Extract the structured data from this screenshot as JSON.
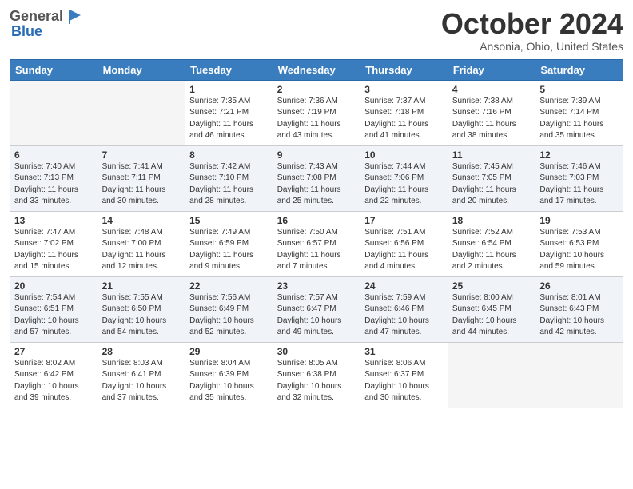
{
  "header": {
    "logo_general": "General",
    "logo_blue": "Blue",
    "month_title": "October 2024",
    "location": "Ansonia, Ohio, United States"
  },
  "days_of_week": [
    "Sunday",
    "Monday",
    "Tuesday",
    "Wednesday",
    "Thursday",
    "Friday",
    "Saturday"
  ],
  "weeks": [
    [
      {
        "day": "",
        "empty": true
      },
      {
        "day": "",
        "empty": true
      },
      {
        "day": "1",
        "sunrise": "Sunrise: 7:35 AM",
        "sunset": "Sunset: 7:21 PM",
        "daylight": "Daylight: 11 hours and 46 minutes."
      },
      {
        "day": "2",
        "sunrise": "Sunrise: 7:36 AM",
        "sunset": "Sunset: 7:19 PM",
        "daylight": "Daylight: 11 hours and 43 minutes."
      },
      {
        "day": "3",
        "sunrise": "Sunrise: 7:37 AM",
        "sunset": "Sunset: 7:18 PM",
        "daylight": "Daylight: 11 hours and 41 minutes."
      },
      {
        "day": "4",
        "sunrise": "Sunrise: 7:38 AM",
        "sunset": "Sunset: 7:16 PM",
        "daylight": "Daylight: 11 hours and 38 minutes."
      },
      {
        "day": "5",
        "sunrise": "Sunrise: 7:39 AM",
        "sunset": "Sunset: 7:14 PM",
        "daylight": "Daylight: 11 hours and 35 minutes."
      }
    ],
    [
      {
        "day": "6",
        "sunrise": "Sunrise: 7:40 AM",
        "sunset": "Sunset: 7:13 PM",
        "daylight": "Daylight: 11 hours and 33 minutes."
      },
      {
        "day": "7",
        "sunrise": "Sunrise: 7:41 AM",
        "sunset": "Sunset: 7:11 PM",
        "daylight": "Daylight: 11 hours and 30 minutes."
      },
      {
        "day": "8",
        "sunrise": "Sunrise: 7:42 AM",
        "sunset": "Sunset: 7:10 PM",
        "daylight": "Daylight: 11 hours and 28 minutes."
      },
      {
        "day": "9",
        "sunrise": "Sunrise: 7:43 AM",
        "sunset": "Sunset: 7:08 PM",
        "daylight": "Daylight: 11 hours and 25 minutes."
      },
      {
        "day": "10",
        "sunrise": "Sunrise: 7:44 AM",
        "sunset": "Sunset: 7:06 PM",
        "daylight": "Daylight: 11 hours and 22 minutes."
      },
      {
        "day": "11",
        "sunrise": "Sunrise: 7:45 AM",
        "sunset": "Sunset: 7:05 PM",
        "daylight": "Daylight: 11 hours and 20 minutes."
      },
      {
        "day": "12",
        "sunrise": "Sunrise: 7:46 AM",
        "sunset": "Sunset: 7:03 PM",
        "daylight": "Daylight: 11 hours and 17 minutes."
      }
    ],
    [
      {
        "day": "13",
        "sunrise": "Sunrise: 7:47 AM",
        "sunset": "Sunset: 7:02 PM",
        "daylight": "Daylight: 11 hours and 15 minutes."
      },
      {
        "day": "14",
        "sunrise": "Sunrise: 7:48 AM",
        "sunset": "Sunset: 7:00 PM",
        "daylight": "Daylight: 11 hours and 12 minutes."
      },
      {
        "day": "15",
        "sunrise": "Sunrise: 7:49 AM",
        "sunset": "Sunset: 6:59 PM",
        "daylight": "Daylight: 11 hours and 9 minutes."
      },
      {
        "day": "16",
        "sunrise": "Sunrise: 7:50 AM",
        "sunset": "Sunset: 6:57 PM",
        "daylight": "Daylight: 11 hours and 7 minutes."
      },
      {
        "day": "17",
        "sunrise": "Sunrise: 7:51 AM",
        "sunset": "Sunset: 6:56 PM",
        "daylight": "Daylight: 11 hours and 4 minutes."
      },
      {
        "day": "18",
        "sunrise": "Sunrise: 7:52 AM",
        "sunset": "Sunset: 6:54 PM",
        "daylight": "Daylight: 11 hours and 2 minutes."
      },
      {
        "day": "19",
        "sunrise": "Sunrise: 7:53 AM",
        "sunset": "Sunset: 6:53 PM",
        "daylight": "Daylight: 10 hours and 59 minutes."
      }
    ],
    [
      {
        "day": "20",
        "sunrise": "Sunrise: 7:54 AM",
        "sunset": "Sunset: 6:51 PM",
        "daylight": "Daylight: 10 hours and 57 minutes."
      },
      {
        "day": "21",
        "sunrise": "Sunrise: 7:55 AM",
        "sunset": "Sunset: 6:50 PM",
        "daylight": "Daylight: 10 hours and 54 minutes."
      },
      {
        "day": "22",
        "sunrise": "Sunrise: 7:56 AM",
        "sunset": "Sunset: 6:49 PM",
        "daylight": "Daylight: 10 hours and 52 minutes."
      },
      {
        "day": "23",
        "sunrise": "Sunrise: 7:57 AM",
        "sunset": "Sunset: 6:47 PM",
        "daylight": "Daylight: 10 hours and 49 minutes."
      },
      {
        "day": "24",
        "sunrise": "Sunrise: 7:59 AM",
        "sunset": "Sunset: 6:46 PM",
        "daylight": "Daylight: 10 hours and 47 minutes."
      },
      {
        "day": "25",
        "sunrise": "Sunrise: 8:00 AM",
        "sunset": "Sunset: 6:45 PM",
        "daylight": "Daylight: 10 hours and 44 minutes."
      },
      {
        "day": "26",
        "sunrise": "Sunrise: 8:01 AM",
        "sunset": "Sunset: 6:43 PM",
        "daylight": "Daylight: 10 hours and 42 minutes."
      }
    ],
    [
      {
        "day": "27",
        "sunrise": "Sunrise: 8:02 AM",
        "sunset": "Sunset: 6:42 PM",
        "daylight": "Daylight: 10 hours and 39 minutes."
      },
      {
        "day": "28",
        "sunrise": "Sunrise: 8:03 AM",
        "sunset": "Sunset: 6:41 PM",
        "daylight": "Daylight: 10 hours and 37 minutes."
      },
      {
        "day": "29",
        "sunrise": "Sunrise: 8:04 AM",
        "sunset": "Sunset: 6:39 PM",
        "daylight": "Daylight: 10 hours and 35 minutes."
      },
      {
        "day": "30",
        "sunrise": "Sunrise: 8:05 AM",
        "sunset": "Sunset: 6:38 PM",
        "daylight": "Daylight: 10 hours and 32 minutes."
      },
      {
        "day": "31",
        "sunrise": "Sunrise: 8:06 AM",
        "sunset": "Sunset: 6:37 PM",
        "daylight": "Daylight: 10 hours and 30 minutes."
      },
      {
        "day": "",
        "empty": true
      },
      {
        "day": "",
        "empty": true
      }
    ]
  ]
}
